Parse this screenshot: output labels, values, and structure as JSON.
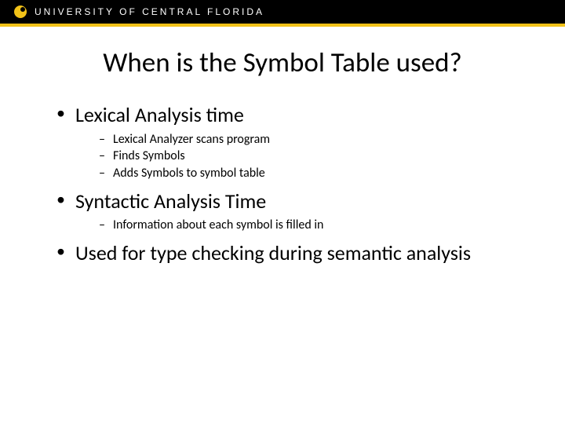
{
  "header": {
    "org": "UNIVERSITY OF CENTRAL FLORIDA"
  },
  "title": "When is the Symbol Table used?",
  "bullets": {
    "b1": "Lexical Analysis time",
    "b1_sub": {
      "s1": "Lexical Analyzer scans program",
      "s2": "Finds Symbols",
      "s3": "Adds Symbols to symbol table"
    },
    "b2": "Syntactic Analysis Time",
    "b2_sub": {
      "s1": "Information about each symbol is filled in"
    },
    "b3": "Used for type checking during semantic analysis"
  }
}
